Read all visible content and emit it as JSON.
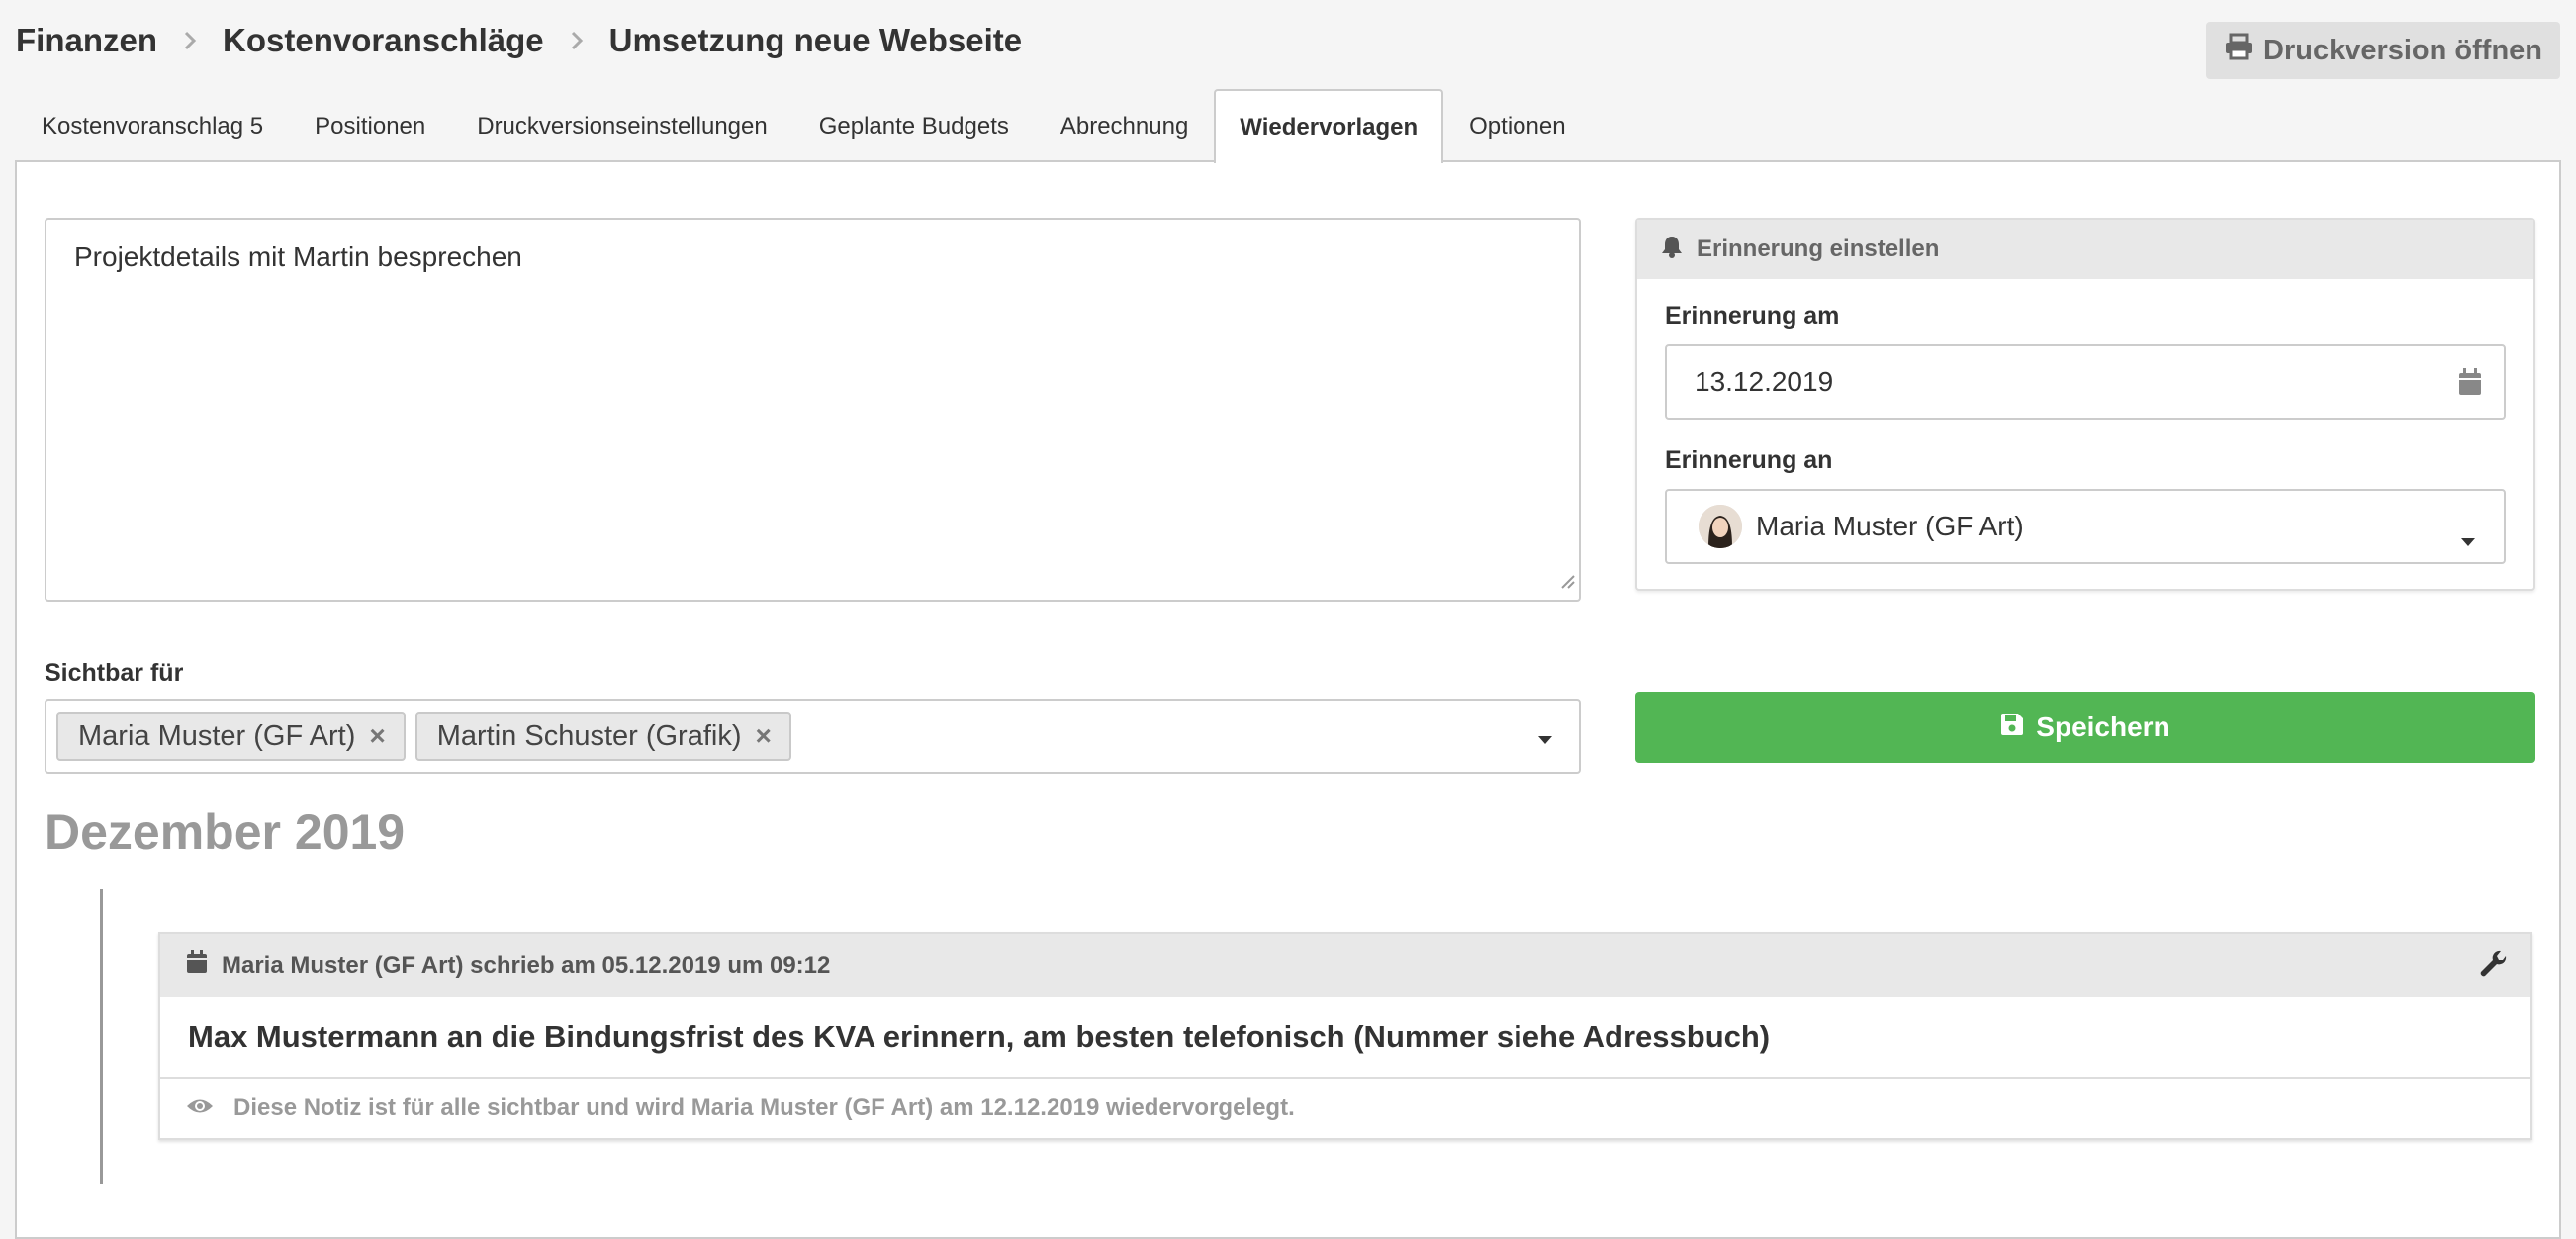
{
  "breadcrumb": {
    "items": [
      "Finanzen",
      "Kostenvoranschläge",
      "Umsetzung neue Webseite"
    ]
  },
  "header": {
    "print_button_label": "Druckversion öffnen",
    "print_icon": "print-icon"
  },
  "tabs": [
    {
      "label": "Kostenvoranschlag 5",
      "active": false
    },
    {
      "label": "Positionen",
      "active": false
    },
    {
      "label": "Druckversionseinstellungen",
      "active": false
    },
    {
      "label": "Geplante Budgets",
      "active": false
    },
    {
      "label": "Abrechnung",
      "active": false
    },
    {
      "label": "Wiedervorlagen",
      "active": true
    },
    {
      "label": "Optionen",
      "active": false
    }
  ],
  "form": {
    "note_text": "Projektdetails mit Martin besprechen",
    "visible_for_label": "Sichtbar für",
    "visible_for_tags": [
      "Maria Muster (GF Art)",
      "Martin Schuster (Grafik)"
    ],
    "tag_remove_symbol": "×"
  },
  "reminder": {
    "title": "Erinnerung einstellen",
    "date_label": "Erinnerung am",
    "date_value": "13.12.2019",
    "person_label": "Erinnerung an",
    "person_value": "Maria Muster (GF Art)"
  },
  "save_button_label": "Speichern",
  "timeline": {
    "month_heading": "Dezember 2019",
    "entries": [
      {
        "meta": "Maria Muster (GF Art) schrieb am 05.12.2019 um 09:12",
        "text": "Max Mustermann an die Bindungsfrist des KVA erinnern, am besten telefonisch (Nummer siehe Adressbuch)",
        "visibility_note": "Diese Notiz ist für alle sichtbar und wird Maria Muster (GF Art) am 12.12.2019 wiedervorgelegt."
      }
    ]
  },
  "colors": {
    "save_green": "#52b654",
    "muted_grey": "#999999"
  }
}
